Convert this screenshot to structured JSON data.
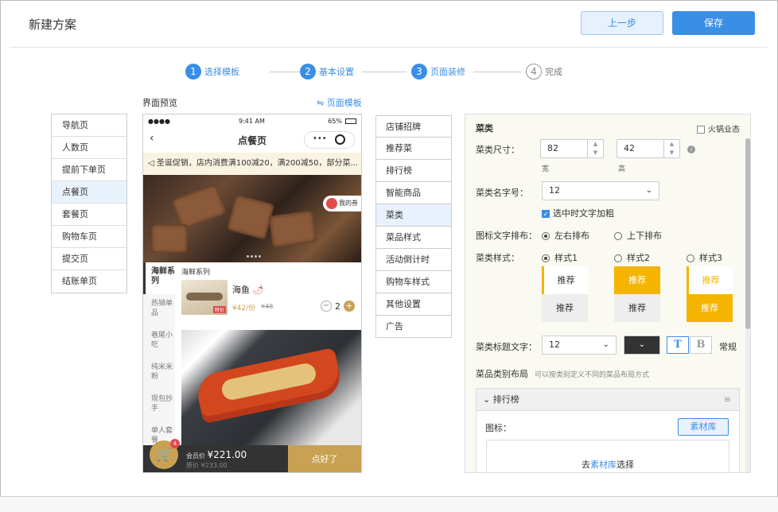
{
  "header": {
    "title": "新建方案",
    "prev_label": "上一步",
    "save_label": "保存"
  },
  "steps": [
    {
      "num": "1",
      "label": "选择模板",
      "active": true
    },
    {
      "num": "2",
      "label": "基本设置",
      "active": true
    },
    {
      "num": "3",
      "label": "页面装修",
      "active": true
    },
    {
      "num": "4",
      "label": "完成",
      "active": false
    }
  ],
  "left_menu": [
    "导航页",
    "人数页",
    "提前下单页",
    "点餐页",
    "套餐页",
    "购物车页",
    "提交页",
    "结账单页"
  ],
  "left_menu_active": "点餐页",
  "preview": {
    "label": "界面预览",
    "template_link": "⇋ 页面模板"
  },
  "phone": {
    "time": "9:41 AM",
    "battery": "65%",
    "nav_title": "点餐页",
    "notice": "圣诞促销，店内消费满100减20，满200减50，部分菜...",
    "coupon": "我的券",
    "categories": [
      {
        "label": "海鲜系列",
        "active": true
      },
      {
        "label": "热销单品",
        "active": false
      },
      {
        "label": "巷尾小吃",
        "active": false
      },
      {
        "label": "纯米米粉",
        "active": false
      },
      {
        "label": "现包抄手",
        "active": false
      },
      {
        "label": "单人套餐",
        "active": false
      }
    ],
    "series_title": "海鲜系列",
    "dish": {
      "name": "海鱼",
      "price": "¥42/份",
      "orig": "¥48",
      "qty": "2",
      "tag": "特价"
    },
    "cart_badge": "4",
    "member_label": "会员价",
    "member_price": "¥221.00",
    "orig_label": "原价",
    "orig_price": "¥233.00",
    "order_btn": "点好了"
  },
  "mid_menu": [
    "店铺招牌",
    "推荐菜",
    "排行榜",
    "智能商品",
    "菜类",
    "菜品样式",
    "活动倒计时",
    "购物车样式",
    "其他设置",
    "广告"
  ],
  "mid_menu_active": "菜类",
  "panel": {
    "section_title": "菜类",
    "hotpot_label": "火锅业态",
    "size_label": "菜类尺寸：",
    "width_value": "82",
    "height_value": "42",
    "width_sub": "宽",
    "height_sub": "高",
    "font_label": "菜类名字号：",
    "font_value": "12",
    "bold_label": "选中时文字加粗",
    "layout_label": "图标文字排布：",
    "layout_opt1": "左右排布",
    "layout_opt2": "上下排布",
    "style_label": "菜类样式：",
    "style_opts": [
      "样式1",
      "样式2",
      "样式3"
    ],
    "rec_label": "推荐",
    "title_font_label": "菜类标题文字：",
    "title_font_value": "12",
    "normal_label": "常规",
    "layout_section": "菜品类别布局",
    "layout_hint": "可以按类别定义不同的菜品布局方式",
    "accordion_title": "排行榜",
    "icon_label": "图标：",
    "lib_btn": "素材库",
    "drop_prefix": "去",
    "drop_link": "素材库",
    "drop_suffix": "选择"
  },
  "colors": {
    "accent": "#3a8ee6",
    "gold": "#c8a152",
    "yellow": "#f5b400"
  }
}
